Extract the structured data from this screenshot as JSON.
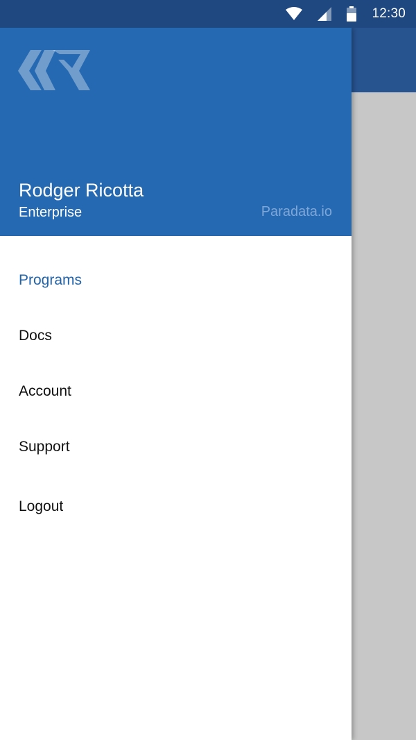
{
  "status_bar": {
    "time": "12:30",
    "icons": [
      "wifi-icon",
      "cellular-signal-icon",
      "battery-icon"
    ]
  },
  "colors": {
    "status_bar": "#1f4780",
    "app_bar": "#27538f",
    "drawer_header": "#2569b2",
    "active_item": "#2162a8",
    "scrim": "#c6c7c6"
  },
  "drawer": {
    "header": {
      "logo": "paradata-logo-icon",
      "user_name": "Rodger Ricotta",
      "plan": "Enterprise",
      "brand": "Paradata.io"
    },
    "menu": [
      {
        "label": "Programs",
        "active": true
      },
      {
        "label": "Docs",
        "active": false
      },
      {
        "label": "Account",
        "active": false
      },
      {
        "label": "Support",
        "active": false
      },
      {
        "label": "Logout",
        "active": false
      }
    ]
  }
}
